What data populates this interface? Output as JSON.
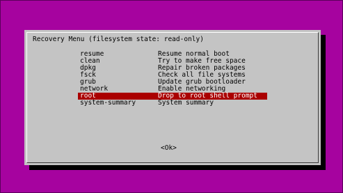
{
  "dialog": {
    "title": "Recovery Menu (filesystem state: read-only)",
    "ok_label": "<Ok>"
  },
  "menu": {
    "selected_index": 6,
    "items": [
      {
        "key": "resume",
        "description": "Resume normal boot"
      },
      {
        "key": "clean",
        "description": "Try to make free space"
      },
      {
        "key": "dpkg",
        "description": "Repair broken packages"
      },
      {
        "key": "fsck",
        "description": "Check all file systems"
      },
      {
        "key": "grub",
        "description": "Update grub bootloader"
      },
      {
        "key": "network",
        "description": "Enable networking"
      },
      {
        "key": "root",
        "description": "Drop to root shell prompt"
      },
      {
        "key": "system-summary",
        "description": "System summary"
      }
    ]
  },
  "colors": {
    "background": "#a6039f",
    "dialog": "#c4c4c4",
    "selection": "#aa0000",
    "selection_text": "#ffffff",
    "text": "#000000"
  }
}
